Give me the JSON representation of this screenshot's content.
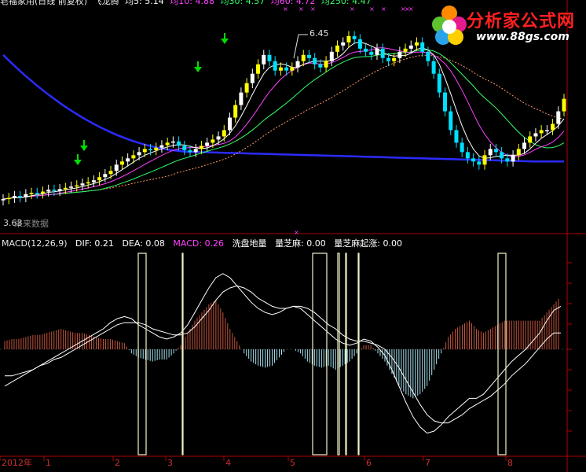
{
  "title_bar": {
    "stock": "皂福家用(日线 前复权)",
    "indicator": "飞龙腾",
    "ma5_label": "均5: 5.14",
    "ma10_label": "均10: 4.88",
    "ma30_label": "均30: 4.57",
    "ma60_label": "均60: 4.72",
    "ma250_label": "均250: 4.47"
  },
  "macd_bar": {
    "name": "MACD(12,26,9)",
    "dif": "DIF: 0.21",
    "dea": "DEA: 0.08",
    "macd": "MACD: 0.26",
    "wash": "洗盘地量",
    "zhima": "量芝麻: 0.00",
    "zhima_rise": "量芝麻起涨: 0.00"
  },
  "labels": {
    "high": "6.45",
    "low": "3.63",
    "future": "未来数据",
    "year": "2012年"
  },
  "logo": {
    "title": "分析家公式网",
    "url": "www.88gs.com"
  },
  "colors": {
    "up": "#ffffff",
    "yellow": "#ffff00",
    "down": "#00e0ff",
    "ma_blue": "#2b2bff",
    "ma5": "#ffffff",
    "ma10": "#ff40ff",
    "ma30": "#33ff66",
    "ma60": "#ff9966",
    "histogram_pos": "#c8553d",
    "histogram_neg": "#a6e3f0",
    "arrow": "#00dd00",
    "markers": "#ff40ff"
  },
  "chart_data": [
    {
      "type": "candlestick",
      "title": "皂福家用(日线 前复权) 飞龙腾",
      "ylim": [
        3.3,
        6.7
      ],
      "high": 6.45,
      "low": 3.63,
      "x_months": [
        "2012年",
        "1",
        "2",
        "3",
        "4",
        "5",
        "6",
        "7",
        "8"
      ],
      "series": [
        {
          "name": "均5",
          "value": 5.14
        },
        {
          "name": "均10",
          "value": 4.88
        },
        {
          "name": "均30",
          "value": 4.57
        },
        {
          "name": "均60",
          "value": 4.72
        },
        {
          "name": "均250",
          "value": 4.47
        }
      ],
      "close": [
        3.7,
        3.72,
        3.75,
        3.73,
        3.78,
        3.8,
        3.79,
        3.82,
        3.85,
        3.83,
        3.86,
        3.88,
        3.9,
        3.92,
        3.95,
        3.97,
        4.0,
        4.05,
        4.1,
        4.15,
        4.25,
        4.3,
        4.35,
        4.4,
        4.45,
        4.5,
        4.48,
        4.52,
        4.56,
        4.6,
        4.62,
        4.55,
        4.48,
        4.45,
        4.5,
        4.55,
        4.6,
        4.65,
        4.7,
        4.8,
        5.0,
        5.2,
        5.4,
        5.55,
        5.7,
        5.85,
        6.0,
        5.9,
        5.75,
        5.8,
        5.75,
        5.8,
        5.9,
        6.0,
        5.95,
        5.85,
        5.8,
        5.9,
        6.05,
        6.15,
        6.2,
        6.3,
        6.25,
        6.1,
        6.05,
        6.0,
        6.1,
        5.95,
        5.9,
        5.95,
        6.05,
        6.1,
        6.15,
        6.2,
        6.05,
        5.9,
        5.7,
        5.4,
        5.1,
        4.8,
        4.6,
        4.45,
        4.35,
        4.3,
        4.25,
        4.4,
        4.5,
        4.45,
        4.35,
        4.3,
        4.4,
        4.5,
        4.6,
        4.7,
        4.75,
        4.8,
        4.8,
        4.9,
        5.1,
        5.3
      ]
    },
    {
      "type": "macd",
      "title": "MACD(12,26,9)",
      "series": [
        {
          "name": "DIF",
          "last": 0.21
        },
        {
          "name": "DEA",
          "last": 0.08
        },
        {
          "name": "MACD",
          "last": 0.26
        }
      ],
      "dif": [
        -0.18,
        -0.16,
        -0.14,
        -0.12,
        -0.1,
        -0.08,
        -0.06,
        -0.04,
        -0.02,
        0.0,
        0.02,
        0.04,
        0.06,
        0.08,
        0.1,
        0.13,
        0.15,
        0.16,
        0.15,
        0.12,
        0.1,
        0.08,
        0.06,
        0.05,
        0.06,
        0.08,
        0.12,
        0.18,
        0.24,
        0.3,
        0.35,
        0.37,
        0.35,
        0.31,
        0.27,
        0.23,
        0.2,
        0.18,
        0.17,
        0.18,
        0.2,
        0.21,
        0.2,
        0.17,
        0.14,
        0.11,
        0.08,
        0.05,
        0.03,
        0.02,
        0.03,
        0.05,
        0.04,
        0.01,
        -0.03,
        -0.1,
        -0.18,
        -0.26,
        -0.33,
        -0.38,
        -0.41,
        -0.4,
        -0.37,
        -0.33,
        -0.3,
        -0.27,
        -0.24,
        -0.24,
        -0.22,
        -0.18,
        -0.14,
        -0.1,
        -0.06,
        -0.03,
        0.0,
        0.04,
        0.08,
        0.14,
        0.19,
        0.21
      ],
      "dea": [
        -0.13,
        -0.13,
        -0.12,
        -0.11,
        -0.1,
        -0.08,
        -0.07,
        -0.05,
        -0.04,
        -0.02,
        0.0,
        0.02,
        0.04,
        0.06,
        0.08,
        0.1,
        0.12,
        0.13,
        0.13,
        0.13,
        0.12,
        0.1,
        0.09,
        0.08,
        0.07,
        0.07,
        0.08,
        0.11,
        0.15,
        0.19,
        0.24,
        0.28,
        0.3,
        0.31,
        0.3,
        0.28,
        0.25,
        0.23,
        0.21,
        0.2,
        0.2,
        0.21,
        0.21,
        0.2,
        0.18,
        0.15,
        0.12,
        0.1,
        0.07,
        0.05,
        0.04,
        0.04,
        0.03,
        0.02,
        0.0,
        -0.04,
        -0.09,
        -0.15,
        -0.21,
        -0.27,
        -0.32,
        -0.35,
        -0.36,
        -0.36,
        -0.34,
        -0.32,
        -0.29,
        -0.27,
        -0.25,
        -0.23,
        -0.2,
        -0.17,
        -0.13,
        -0.1,
        -0.07,
        -0.03,
        0.01,
        0.05,
        0.08,
        0.08
      ],
      "macd": [
        0.04,
        0.05,
        0.05,
        0.06,
        0.07,
        0.07,
        0.08,
        0.09,
        0.1,
        0.09,
        0.08,
        0.08,
        0.07,
        0.06,
        0.05,
        0.05,
        0.04,
        0.03,
        -0.02,
        -0.04,
        -0.05,
        -0.06,
        -0.05,
        -0.05,
        -0.02,
        0.02,
        0.08,
        0.14,
        0.18,
        0.22,
        0.24,
        0.18,
        0.1,
        0.04,
        -0.02,
        -0.06,
        -0.08,
        -0.09,
        -0.08,
        -0.04,
        0.0,
        0.0,
        -0.02,
        -0.06,
        -0.08,
        -0.09,
        -0.08,
        -0.1,
        -0.08,
        -0.06,
        -0.02,
        0.02,
        0.02,
        -0.02,
        -0.06,
        -0.12,
        -0.18,
        -0.22,
        -0.24,
        -0.22,
        -0.18,
        -0.1,
        -0.02,
        0.06,
        0.1,
        0.12,
        0.14,
        0.1,
        0.08,
        0.1,
        0.12,
        0.14,
        0.14,
        0.14,
        0.14,
        0.14,
        0.14,
        0.18,
        0.22,
        0.26
      ]
    }
  ]
}
